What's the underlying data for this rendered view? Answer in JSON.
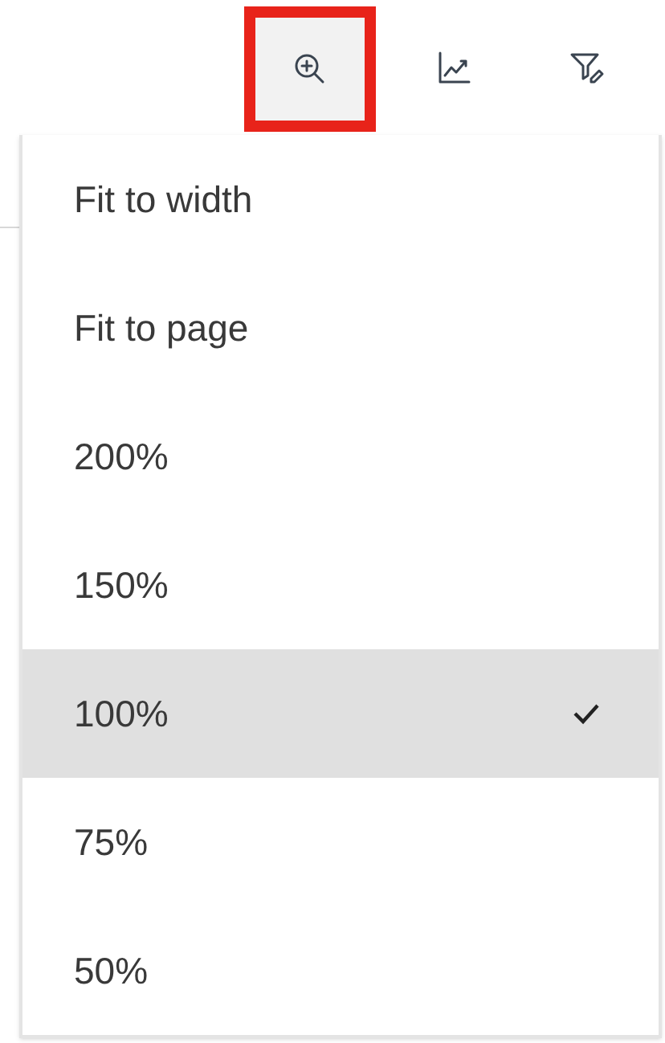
{
  "toolbar": {
    "buttons": [
      {
        "kind": "zoom",
        "highlighted": true
      },
      {
        "kind": "chart",
        "highlighted": false
      },
      {
        "kind": "filter",
        "highlighted": false
      }
    ]
  },
  "zoom_menu": {
    "items": [
      {
        "label": "Fit to width",
        "selected": false
      },
      {
        "label": "Fit to page",
        "selected": false
      },
      {
        "label": "200%",
        "selected": false
      },
      {
        "label": "150%",
        "selected": false
      },
      {
        "label": "100%",
        "selected": true
      },
      {
        "label": "75%",
        "selected": false
      },
      {
        "label": "50%",
        "selected": false
      }
    ]
  }
}
